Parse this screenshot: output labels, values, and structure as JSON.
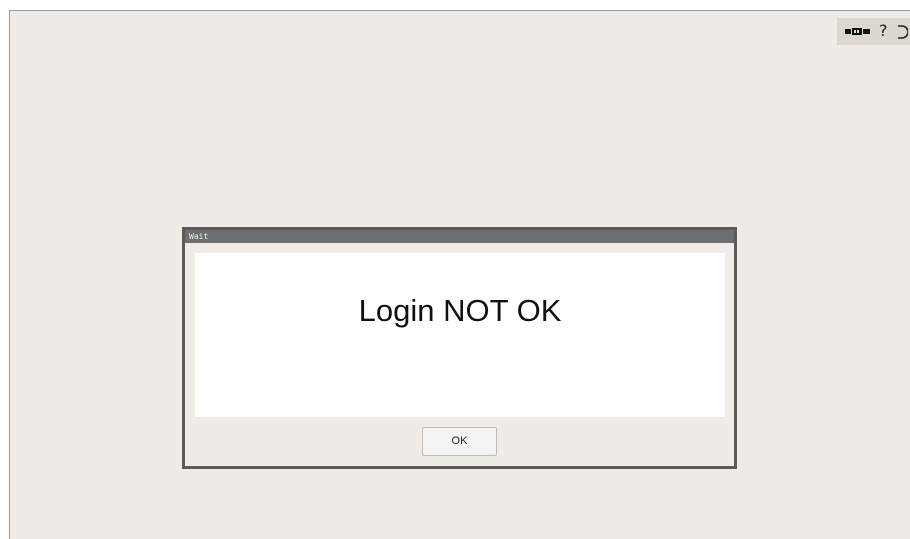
{
  "system_tray": {
    "icons": [
      "keyboard-icon",
      "help-icon",
      "power-icon"
    ],
    "help_glyph": "?"
  },
  "dialog": {
    "title": "Wait",
    "message": "Login NOT OK",
    "ok_label": "OK"
  },
  "colors": {
    "desktop_background": "#efece7",
    "dialog_titlebar": "#6e6e6e",
    "dialog_border": "#5b5b5b",
    "message_panel": "#ffffff"
  }
}
